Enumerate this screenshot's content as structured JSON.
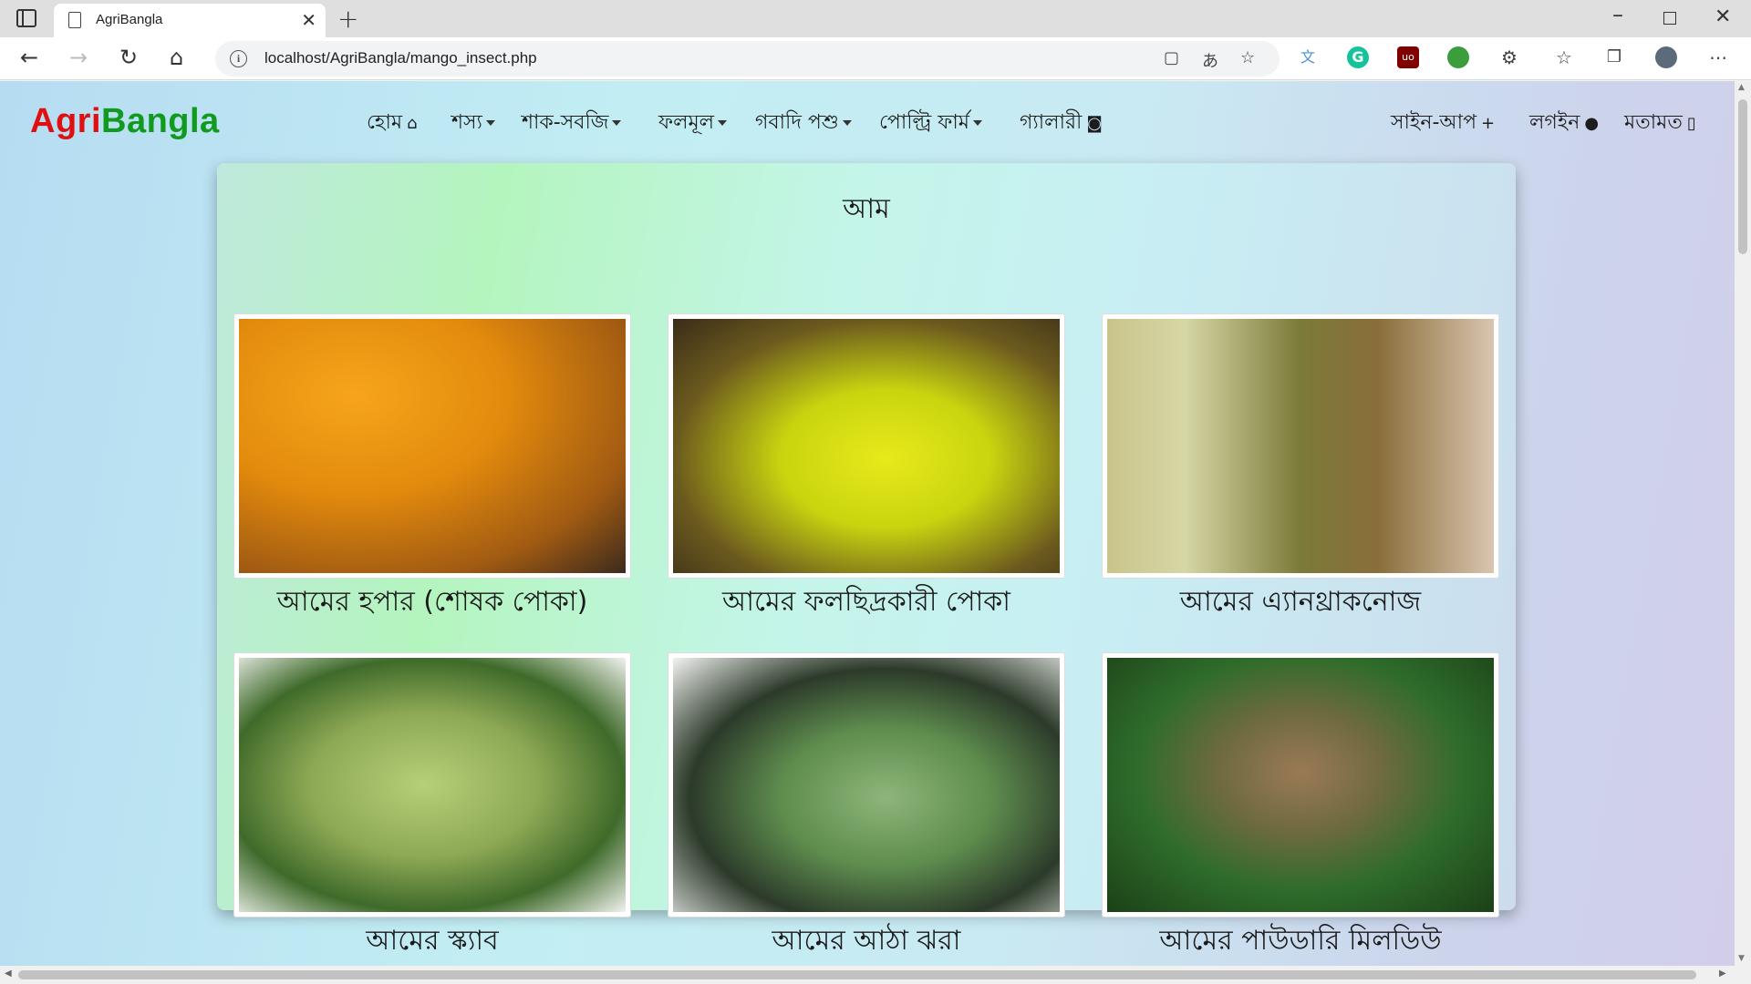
{
  "browser": {
    "tab_title": "AgriBangla",
    "url": "localhost/AgriBangla/mango_insect.php",
    "close_tab": "✕",
    "new_tab": "+"
  },
  "site": {
    "brand_part1": "Agri",
    "brand_part2": "Bangla",
    "nav": {
      "home": "হোম",
      "crops": "শস্য",
      "vegetables": "শাক-সবজি",
      "fruits": "ফলমূল",
      "livestock": "গবাদি পশু",
      "poultry": "পোল্ট্রি ফার্ম",
      "gallery": "গ্যালারী",
      "signup": "সাইন-আপ",
      "login": "লগইন",
      "feedback": "মতামত"
    }
  },
  "content": {
    "title": "আম",
    "items": [
      {
        "caption": "আমের হপার (শোষক পোকা)",
        "image": "mango-hopper-photo"
      },
      {
        "caption": "আমের ফলছিদ্রকারী পোকা",
        "image": "mango-fruit-borer-photo"
      },
      {
        "caption": "আমের এ্যানথ্রাকনোজ",
        "image": "mango-anthracnose-photo"
      },
      {
        "caption": "আমের স্ক্যাব",
        "image": "mango-scab-photo"
      },
      {
        "caption": "আমের আঠা ঝরা",
        "image": "mango-gummosis-photo"
      },
      {
        "caption": "আমের পাউডারি মিলডিউ",
        "image": "mango-powdery-mildew-photo"
      }
    ]
  },
  "colors": {
    "brand_red": "#e01010",
    "brand_green": "#109a1e"
  }
}
